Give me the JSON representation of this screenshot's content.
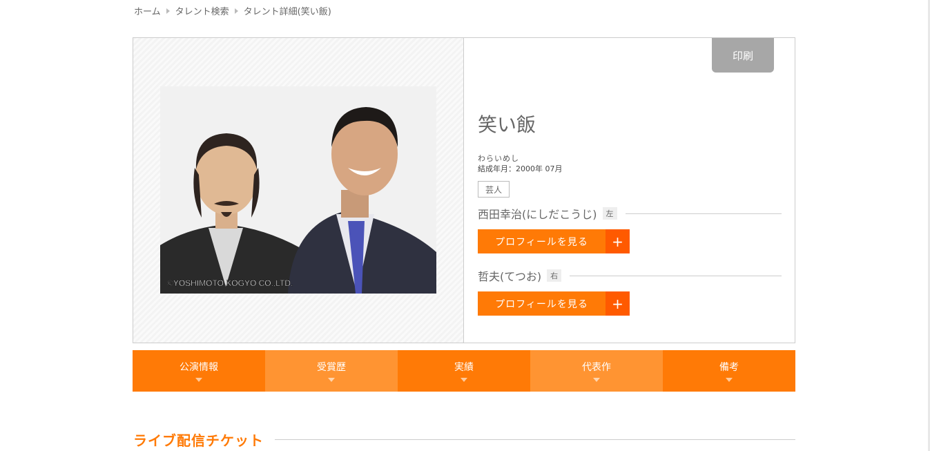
{
  "breadcrumb": [
    "ホーム",
    "タレント検索",
    "タレント詳細(笑い飯)"
  ],
  "talent": {
    "name": "笑い飯",
    "kana": "わらいめし",
    "formed_label": "結成年月：",
    "formed_value": "2000年 07月",
    "tag": "芸人",
    "photo_credit": "©YOSHIMOTO KOGYO CO.,LTD.",
    "members": [
      {
        "name": "西田幸治(にしだこうじ)",
        "position": "左",
        "button": "プロフィールを見る",
        "plus": "+"
      },
      {
        "name": "哲夫(てつお)",
        "position": "右",
        "button": "プロフィールを見る",
        "plus": "+"
      }
    ]
  },
  "print_label": "印刷",
  "tabs": [
    "公演情報",
    "受賞歴",
    "実績",
    "代表作",
    "備考"
  ],
  "section_title": "ライブ配信チケット",
  "colors": {
    "accent": "#ff7a06",
    "accent_dark": "#ff5a00",
    "accent_light": "#ff9432",
    "print_bg": "#a7a7a7"
  }
}
